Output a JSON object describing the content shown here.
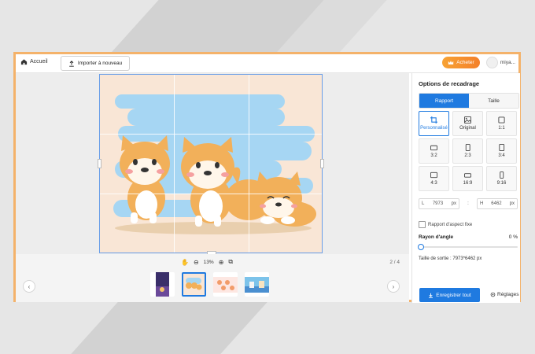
{
  "topbar": {
    "home_label": "Accueil",
    "import_label": "Importer à nouveau",
    "buy_label": "Acheter",
    "user_name": "miya..."
  },
  "editor": {
    "zoom_level": "13%",
    "pager": "2 / 4"
  },
  "panel": {
    "title": "Options de recadrage",
    "tabs": [
      {
        "label": "Rapport",
        "active": true
      },
      {
        "label": "Taille",
        "active": false
      }
    ],
    "ratios": [
      {
        "label": "Personnalisé",
        "icon": "crop-icon",
        "selected": true
      },
      {
        "label": "Original",
        "icon": "image-icon",
        "selected": false
      },
      {
        "label": "1:1",
        "icon": "square-icon",
        "selected": false
      },
      {
        "label": "3:2",
        "icon": "landscape-icon",
        "selected": false
      },
      {
        "label": "2:3",
        "icon": "portrait-icon",
        "selected": false
      },
      {
        "label": "3:4",
        "icon": "portrait-icon",
        "selected": false
      },
      {
        "label": "4:3",
        "icon": "landscape-icon",
        "selected": false
      },
      {
        "label": "16:9",
        "icon": "wide-icon",
        "selected": false
      },
      {
        "label": "9:16",
        "icon": "tall-icon",
        "selected": false
      }
    ],
    "width_prefix": "L",
    "width_value": "7973",
    "width_unit": "px",
    "separator": ":",
    "height_prefix": "H",
    "height_value": "6462",
    "height_unit": "px",
    "keep_ratio_label": "Rapport d'aspect fixe",
    "corner_radius_label": "Rayon d'angle",
    "corner_radius_value": "0 %",
    "output_size_label": "Taille de sortie :",
    "output_size_value": "7973*6462 px",
    "save_label": "Enregistrer tout",
    "settings_label": "Réglages"
  },
  "colors": {
    "accent": "#1f7ae0",
    "frame": "#f4b26a",
    "buy": "#f7a233"
  }
}
